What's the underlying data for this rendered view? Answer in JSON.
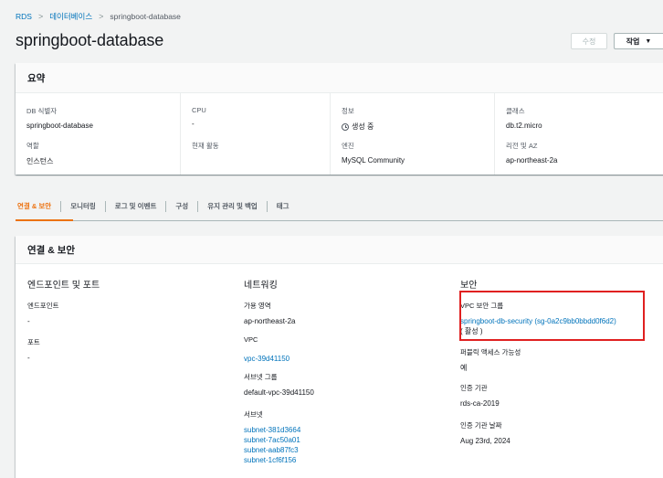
{
  "breadcrumb": {
    "items": [
      "RDS",
      "데이터베이스",
      "springboot-database"
    ],
    "separator": ">"
  },
  "page": {
    "title": "springboot-database"
  },
  "buttons": {
    "edit": "수정",
    "actions": "작업",
    "actions_caret": "▼"
  },
  "summary": {
    "title": "요약",
    "fields": {
      "db_id_label": "DB 식별자",
      "db_id": "springboot-database",
      "cpu_label": "CPU",
      "cpu": "-",
      "info_label": "정보",
      "info": "생성 중",
      "class_label": "클래스",
      "class": "db.t2.micro",
      "role_label": "역할",
      "role": "인스턴스",
      "activity_label": "현재 활동",
      "activity": "",
      "engine_label": "엔진",
      "engine": "MySQL Community",
      "region_label": "리전 및 AZ",
      "region": "ap-northeast-2a"
    }
  },
  "tabs": [
    {
      "label": "연결 & 보안",
      "active": true
    },
    {
      "label": "모니터링"
    },
    {
      "label": "로그 및 이벤트"
    },
    {
      "label": "구성"
    },
    {
      "label": "유지 관리 및 백업"
    },
    {
      "label": "태그"
    }
  ],
  "connectivity": {
    "title": "연결 & 보안",
    "endpoint_section": {
      "title": "엔드포인트 및 포트",
      "endpoint_label": "엔드포인트",
      "endpoint": "-",
      "port_label": "포트",
      "port": "-"
    },
    "network_section": {
      "title": "네트워킹",
      "az_label": "가용 영역",
      "az": "ap-northeast-2a",
      "vpc_label": "VPC",
      "vpc": "vpc-39d41150",
      "subnet_group_label": "서브넷 그룹",
      "subnet_group": "default-vpc-39d41150",
      "subnets_label": "서브넷",
      "subnets": [
        "subnet-381d3664",
        "subnet-7ac50a01",
        "subnet-aab87fc3",
        "subnet-1cf6f156"
      ]
    },
    "security_section": {
      "title": "보안",
      "sg_label": "VPC 보안 그룹",
      "sg": "springboot-db-security (sg-0a2c9bb0bbdd0f6d2)",
      "sg_status": "( 활성 )",
      "public_label": "퍼블릭 액세스 가능성",
      "public": "예",
      "ca_label": "인증 기관",
      "ca": "rds-ca-2019",
      "ca_date_label": "인증 기관 날짜",
      "ca_date": "Aug 23rd, 2024"
    }
  },
  "colors": {
    "accent": "#ec7211",
    "link": "#0073bb",
    "highlight": "#e02020",
    "active_status": "#1d8102"
  }
}
